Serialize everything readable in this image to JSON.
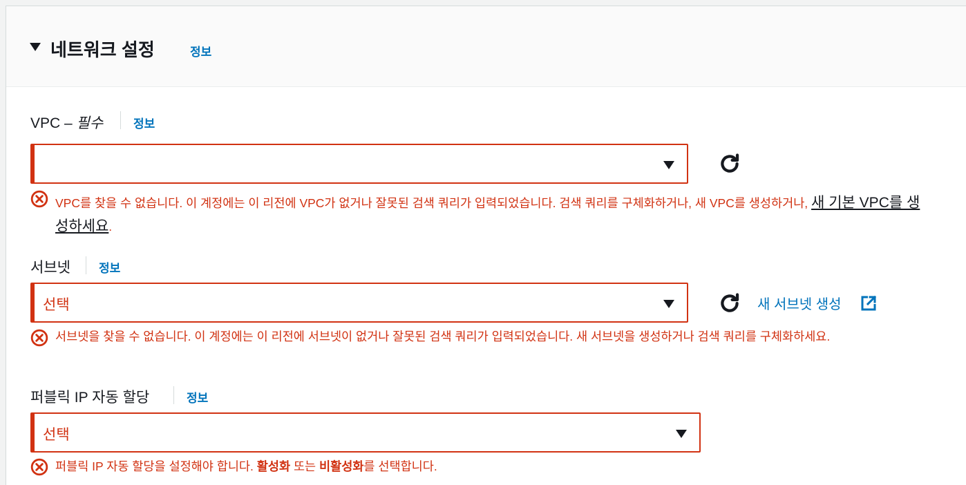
{
  "section": {
    "title": "네트워크 설정",
    "info": "정보"
  },
  "vpc": {
    "label": "VPC – ",
    "required": "필수",
    "info": "정보",
    "value": "",
    "error_text": "VPC를 찾을 수 없습니다. 이 계정에는 이 리전에 VPC가 없거나 잘못된 검색 쿼리가 입력되었습니다. 검색 쿼리를 구체화하거나, 새 VPC를 생성하거나, ",
    "error_link": "새 기본 VPC를 생성하세요",
    "error_end": "."
  },
  "subnet": {
    "label": "서브넷",
    "info": "정보",
    "value": "선택",
    "create_link": "새 서브넷 생성",
    "error_text": "서브넷을 찾을 수 없습니다. 이 계정에는 이 리전에 서브넷이 없거나 잘못된 검색 쿼리가 입력되었습니다. 새 서브넷을 생성하거나 검색 쿼리를 구체화하세요."
  },
  "public_ip": {
    "label": "퍼블릭 IP 자동 할당",
    "info": "정보",
    "value": "선택",
    "error_prefix": "퍼블릭 IP 자동 할당을 설정해야 합니다. ",
    "error_enable": "활성화",
    "error_mid": " 또는 ",
    "error_disable": "비활성화",
    "error_suffix": "를 선택합니다."
  },
  "colors": {
    "error": "#d13212",
    "link": "#0073bb",
    "text": "#16191f"
  }
}
